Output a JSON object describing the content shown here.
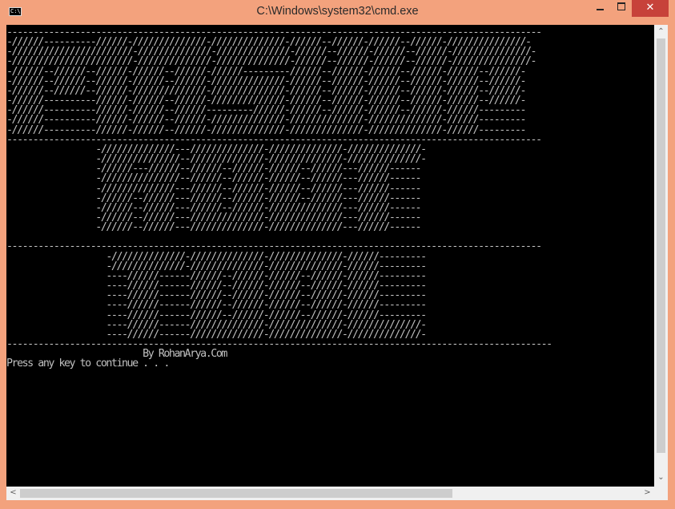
{
  "window": {
    "title": "C:\\Windows\\system32\\cmd.exe",
    "icon_text": "C:\\",
    "close_glyph": "✕"
  },
  "console": {
    "lines": [
      "------------------------------------------------------------------------------------------------------",
      "-//////----------//////-//////////////-//////////////-//////--//////-//////--//////-///////////////-",
      "-///////////////////////-//////////////-//////////////-//////--//////-//////--//////-///////////////-",
      "-///////////////////////-//////////////-//////////////-//////--//////-//////--//////-///////////////-",
      "-//////--//////--//////-//////--//////-//////---------//////--//////-//////--//////-//////--//////-",
      "-//////--//////--//////-//////--//////-//////////////-//////--//////-//////--//////-//////--//////-",
      "-//////--//////--//////-//////////////-//////////////-//////--//////-//////--//////-//////--//////-",
      "-//////----------//////-//////--//////-//////////////-//////--//////-//////--//////-//////--//////-",
      "-//////----------//////-//////--//////---------//////-//////--//////-//////--//////-//////---------",
      "-//////----------//////-//////--//////-//////////////-//////////////-//////////////-//////---------",
      "-//////----------//////-//////--//////-//////////////-//////////////-//////////////-//////---------",
      "------------------------------------------------------------------------------------------------------",
      "                 -//////////////---//////////////-//////////////-//////////////-",
      "                 -///////////////--//////////////-//////////////-//////////////-",
      "                 -//////---//////--//////--//////-//////--//////---//////------",
      "                 -///////////////--//////--//////-//////--//////---//////------",
      "                 -//////////////---//////--//////-//////--//////---//////------",
      "                 -//////--//////---//////--//////-//////--//////---//////------",
      "                 -//////--//////---//////--//////-//////////////---//////------",
      "                 -//////--//////---//////////////-//////////////---//////------",
      "                 -//////--//////---//////////////-//////////////---//////------",
      "",
      "------------------------------------------------------------------------------------------------------",
      "                   -//////////////-//////////////-//////////////-//////---------",
      "                   -//////////////-//////////////-//////////////-//////---------",
      "                   ----//////------//////--//////-//////--//////-//////---------",
      "                   ----//////------//////--//////-//////--//////-//////---------",
      "                   ----//////------//////--//////-//////--//////-//////---------",
      "                   ----//////------//////--//////-//////--//////-//////---------",
      "                   ----//////------//////--//////-//////--//////-//////---------",
      "                   ----//////------//////////////-//////////////-//////////////-",
      "                   ----//////------//////////////-//////////////-//////////////-",
      "--------------------------------------------------------------------------------------------------------",
      "                          By RohanArya.Com",
      "Press any key to continue . . ."
    ]
  },
  "scrollbars": {
    "up_glyph": "⌃",
    "down_glyph": "⌄",
    "left_glyph": "<",
    "right_glyph": ">"
  }
}
